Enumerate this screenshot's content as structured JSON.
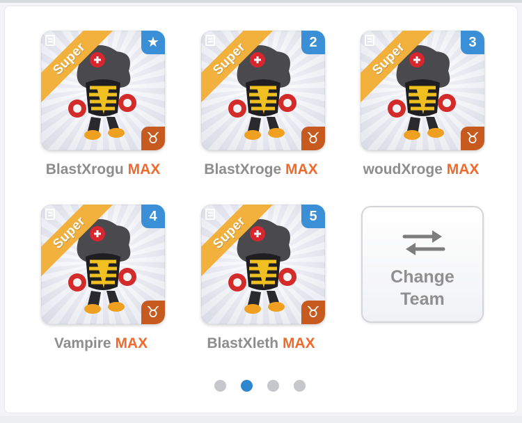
{
  "team": {
    "slots": [
      {
        "name": "BlastXrogu",
        "level": "MAX",
        "slot": "★",
        "ribbon": "Super",
        "sign": "♉"
      },
      {
        "name": "BlastXroge",
        "level": "MAX",
        "slot": "2",
        "ribbon": "Super",
        "sign": "♉"
      },
      {
        "name": "woudXroge",
        "level": "MAX",
        "slot": "3",
        "ribbon": "Super",
        "sign": "♉"
      },
      {
        "name": "Vampire",
        "level": "MAX",
        "slot": "4",
        "ribbon": "Super",
        "sign": "♉"
      },
      {
        "name": "BlastXleth",
        "level": "MAX",
        "slot": "5",
        "ribbon": "Super",
        "sign": "♉"
      }
    ],
    "change_button": {
      "line1": "Change",
      "line2": "Team",
      "icon": "swap-arrows-icon"
    }
  },
  "pagination": {
    "count": 4,
    "active_index": 1
  },
  "colors": {
    "accent_blue": "#3a8fd6",
    "max_orange": "#ef6a2c",
    "ribbon_gold": "#f2b03c",
    "sign_orange": "#c75b1f"
  }
}
